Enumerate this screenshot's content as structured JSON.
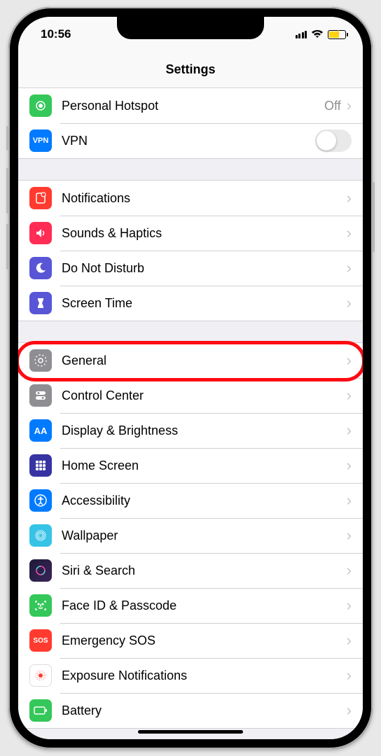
{
  "status": {
    "time": "10:56"
  },
  "nav": {
    "title": "Settings"
  },
  "section1": {
    "hotspot": {
      "label": "Personal Hotspot",
      "value": "Off",
      "iconColor": "#34c759",
      "iconGlyph": "⦾"
    },
    "vpn": {
      "label": "VPN",
      "iconColor": "#007aff",
      "iconText": "VPN"
    }
  },
  "section2": {
    "notifications": {
      "label": "Notifications",
      "iconColor": "#ff3b30"
    },
    "sounds": {
      "label": "Sounds & Haptics",
      "iconColor": "#ff2d55"
    },
    "dnd": {
      "label": "Do Not Disturb",
      "iconColor": "#5856d6"
    },
    "screentime": {
      "label": "Screen Time",
      "iconColor": "#5856d6"
    }
  },
  "section3": {
    "general": {
      "label": "General",
      "iconColor": "#8e8e93"
    },
    "controlcenter": {
      "label": "Control Center",
      "iconColor": "#8e8e93"
    },
    "display": {
      "label": "Display & Brightness",
      "iconColor": "#007aff",
      "iconText": "AA"
    },
    "homescreen": {
      "label": "Home Screen",
      "iconColor": "#2f2a8e"
    },
    "accessibility": {
      "label": "Accessibility",
      "iconColor": "#007aff"
    },
    "wallpaper": {
      "label": "Wallpaper",
      "iconColor": "#37c3e6"
    },
    "siri": {
      "label": "Siri & Search",
      "iconColor": "#1b1b2e"
    },
    "faceid": {
      "label": "Face ID & Passcode",
      "iconColor": "#34c759"
    },
    "sos": {
      "label": "Emergency SOS",
      "iconColor": "#ff3b30",
      "iconText": "SOS"
    },
    "exposure": {
      "label": "Exposure Notifications",
      "iconColor": "#ffffff"
    },
    "battery": {
      "label": "Battery",
      "iconColor": "#34c759"
    }
  }
}
